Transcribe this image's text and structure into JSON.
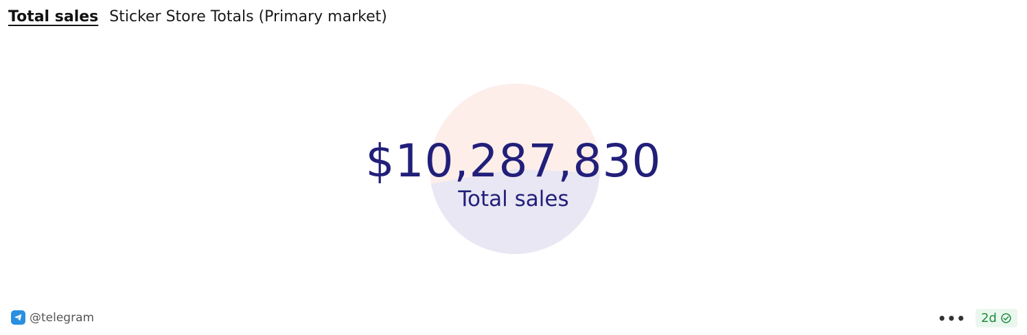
{
  "header": {
    "active_tab": "Total sales",
    "subtitle": "Sticker Store Totals (Primary market)"
  },
  "counter": {
    "value": "$10,287,830",
    "label": "Total sales"
  },
  "footer": {
    "owner_handle": "@telegram",
    "owner_icon": "telegram-icon",
    "more_icon": "more-icon",
    "more_label": "•••",
    "freshness": "2d",
    "freshness_icon": "check-circle-icon"
  },
  "colors": {
    "text_primary": "#221f7a",
    "pie_slice_1": "#fdeeea",
    "pie_slice_2": "#e8e7f3",
    "badge_text": "#1e8a3d",
    "badge_bg": "#eaf7ee"
  }
}
